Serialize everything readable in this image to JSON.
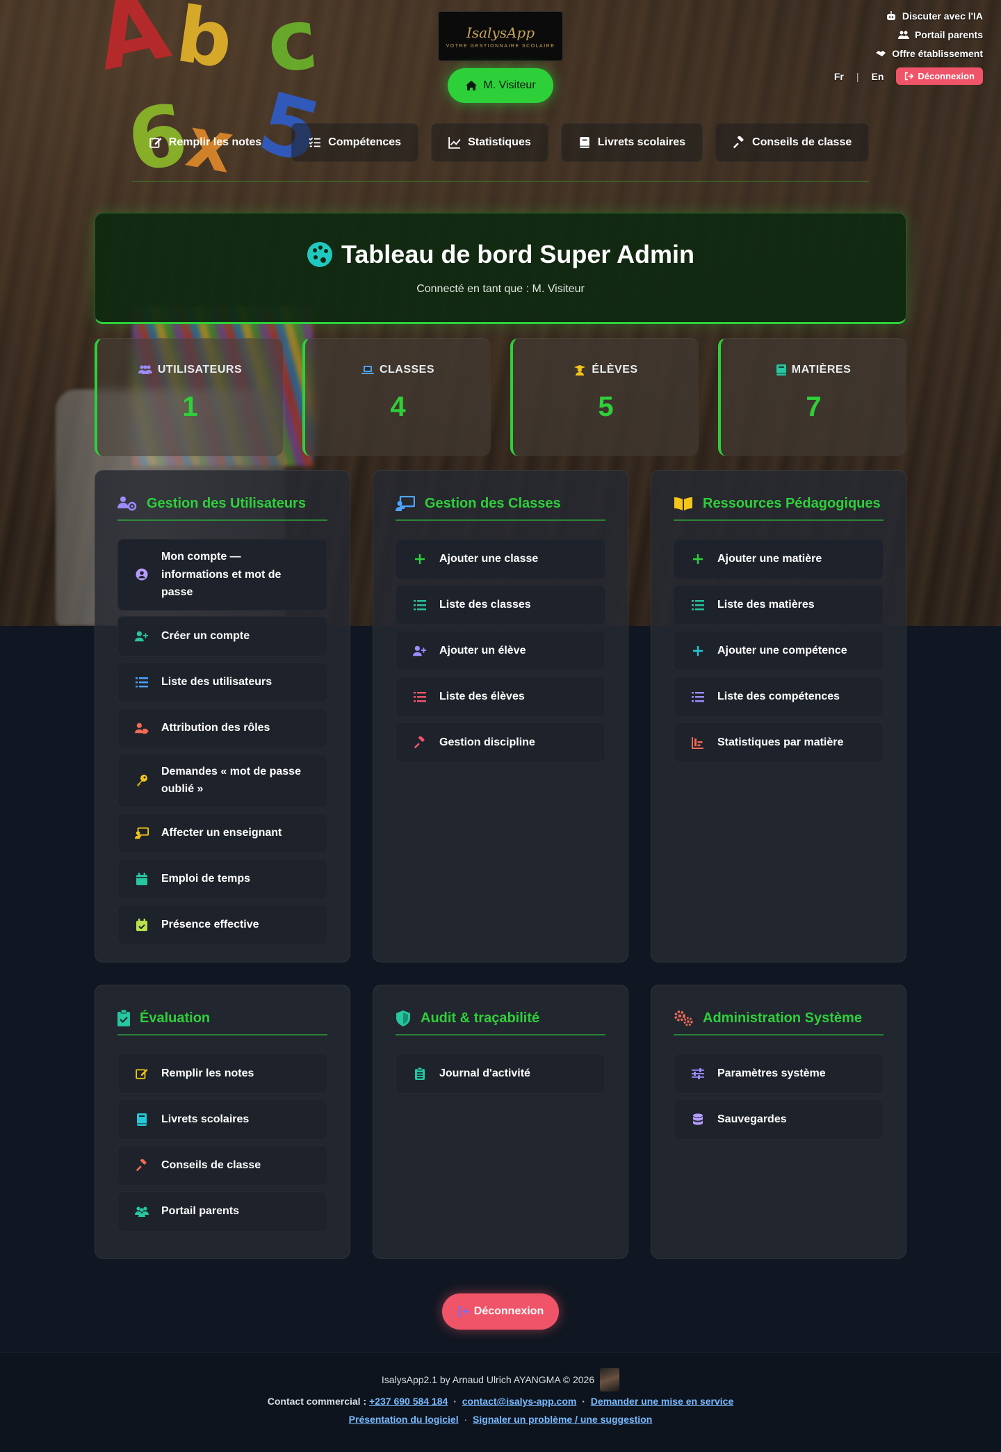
{
  "header": {
    "right_links": [
      {
        "label": "Discuter avec l'IA",
        "icon": "robot-icon"
      },
      {
        "label": "Portail parents",
        "icon": "users-icon"
      },
      {
        "label": "Offre établissement",
        "icon": "handshake-icon"
      }
    ],
    "lang_fr": "Fr",
    "lang_sep": "|",
    "lang_en": "En",
    "logout_label": "Déconnexion",
    "logo_title": "IsalysApp",
    "logo_subtitle": "VOTRE GESTIONNAIRE SCOLAIRE",
    "user_label": "M. Visiteur"
  },
  "nav": [
    {
      "label": "Remplir les notes",
      "icon": "edit-icon"
    },
    {
      "label": "Compétences",
      "icon": "checklist-icon"
    },
    {
      "label": "Statistiques",
      "icon": "chart-line-icon"
    },
    {
      "label": "Livrets scolaires",
      "icon": "book-icon"
    },
    {
      "label": "Conseils de classe",
      "icon": "gavel-icon"
    }
  ],
  "hero": {
    "title": "Tableau de bord Super Admin",
    "subtitle": "Connecté en tant que : M. Visiteur"
  },
  "stats": [
    {
      "label": "UTILISATEURS",
      "value": "1",
      "icon": "users-icon",
      "icon_color": "#9b8cff"
    },
    {
      "label": "CLASSES",
      "value": "4",
      "icon": "laptop-icon",
      "icon_color": "#4da3ff"
    },
    {
      "label": "ÉLÈVES",
      "value": "5",
      "icon": "student-icon",
      "icon_color": "#f5c518"
    },
    {
      "label": "MATIÈRES",
      "value": "7",
      "icon": "book-icon",
      "icon_color": "#25c6a0"
    }
  ],
  "panels": [
    {
      "title": "Gestion des Utilisateurs",
      "icon": "users-cog-icon",
      "icon_color": "#9b8cff",
      "items": [
        {
          "label": "Mon compte — informations et mot de passe",
          "icon": "user-circle-icon",
          "color": "#b69cff"
        },
        {
          "label": "Créer un compte",
          "icon": "user-plus-icon",
          "color": "#25c6a0"
        },
        {
          "label": "Liste des utilisateurs",
          "icon": "list-icon",
          "color": "#4da3ff"
        },
        {
          "label": "Attribution des rôles",
          "icon": "user-tag-icon",
          "color": "#f06a55"
        },
        {
          "label": "Demandes « mot de passe oublié »",
          "icon": "key-icon",
          "color": "#f5c518"
        },
        {
          "label": "Affecter un enseignant",
          "icon": "chalkboard-teacher-icon",
          "color": "#f5c518"
        },
        {
          "label": "Emploi de temps",
          "icon": "calendar-icon",
          "color": "#25c6a0"
        },
        {
          "label": "Présence effective",
          "icon": "calendar-check-icon",
          "color": "#b8e04a"
        }
      ]
    },
    {
      "title": "Gestion des Classes",
      "icon": "chalkboard-icon",
      "icon_color": "#4da3ff",
      "items": [
        {
          "label": "Ajouter une classe",
          "icon": "plus-icon",
          "color": "#2ed03a"
        },
        {
          "label": "Liste des classes",
          "icon": "list-icon",
          "color": "#25c6a0"
        },
        {
          "label": "Ajouter un élève",
          "icon": "user-plus-icon",
          "color": "#9b8cff"
        },
        {
          "label": "Liste des élèves",
          "icon": "list-icon",
          "color": "#f05468"
        },
        {
          "label": "Gestion discipline",
          "icon": "gavel-icon",
          "color": "#f05468"
        }
      ]
    },
    {
      "title": "Ressources Pédagogiques",
      "icon": "book-open-icon",
      "icon_color": "#f5c518",
      "items": [
        {
          "label": "Ajouter une matière",
          "icon": "plus-icon",
          "color": "#2ed03a"
        },
        {
          "label": "Liste des matières",
          "icon": "list-icon",
          "color": "#25c6a0"
        },
        {
          "label": "Ajouter une compétence",
          "icon": "plus-icon",
          "color": "#25c6d6"
        },
        {
          "label": "Liste des compétences",
          "icon": "list-icon",
          "color": "#9b8cff"
        },
        {
          "label": "Statistiques par matière",
          "icon": "chart-bar-icon",
          "color": "#f06a55"
        }
      ]
    },
    {
      "title": "Évaluation",
      "icon": "clipboard-check-icon",
      "icon_color": "#25c6a0",
      "items": [
        {
          "label": "Remplir les notes",
          "icon": "edit-icon",
          "color": "#f5c518"
        },
        {
          "label": "Livrets scolaires",
          "icon": "book-icon",
          "color": "#25c6d6"
        },
        {
          "label": "Conseils de classe",
          "icon": "gavel-icon",
          "color": "#f06a55"
        },
        {
          "label": "Portail parents",
          "icon": "users-icon",
          "color": "#25c6a0"
        }
      ]
    },
    {
      "title": "Audit & traçabilité",
      "icon": "shield-icon",
      "icon_color": "#25c6a0",
      "items": [
        {
          "label": "Journal d'activité",
          "icon": "clipboard-list-icon",
          "color": "#25c6a0"
        }
      ]
    },
    {
      "title": "Administration Système",
      "icon": "cogs-icon",
      "icon_color": "#f06a55",
      "items": [
        {
          "label": "Paramètres système",
          "icon": "sliders-icon",
          "color": "#9b8cff"
        },
        {
          "label": "Sauvegardes",
          "icon": "database-icon",
          "color": "#b69cff"
        }
      ]
    }
  ],
  "logout_big_label": "Déconnexion",
  "footer": {
    "credits": "IsalysApp2.1 by Arnaud Ulrich AYANGMA © 2026",
    "contact_label": "Contact commercial :",
    "phone": "+237 690 584 184",
    "dot": "·",
    "email": "contact@isalys-app.com",
    "request": "Demander une mise en service",
    "presentation": "Présentation du logiciel",
    "report": "Signaler un problème / une suggestion"
  },
  "colors": {
    "accent": "#2ed03a",
    "danger": "#f05468",
    "background": "#111722"
  }
}
